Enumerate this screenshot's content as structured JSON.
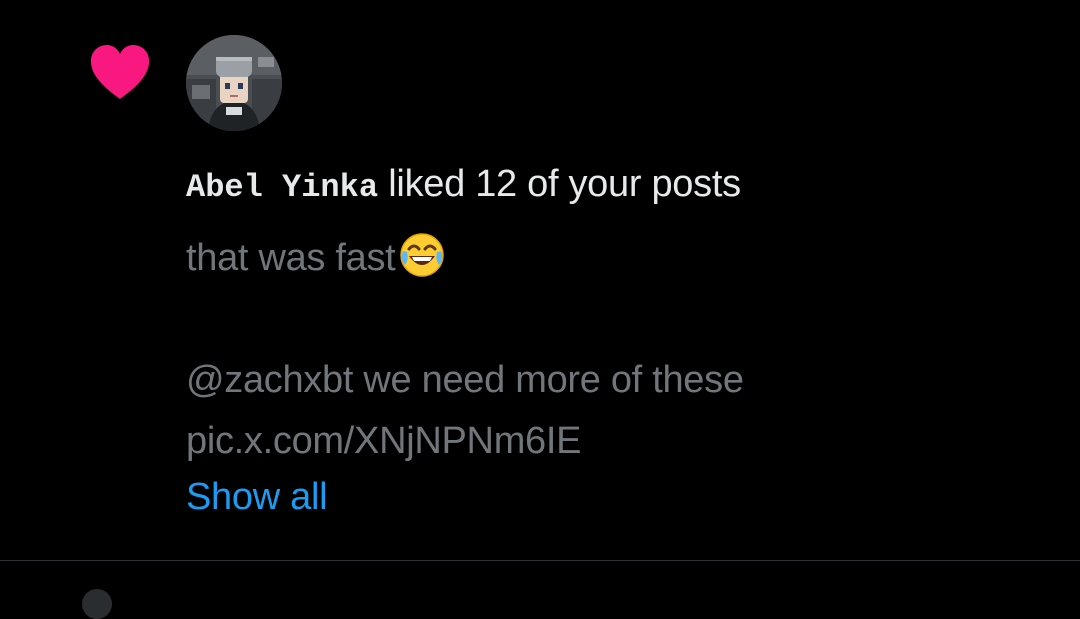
{
  "notification": {
    "type_icon": "heart-icon",
    "type_icon_color": "#f91880",
    "avatar_icon": "avatar-image",
    "user_name": "Abel Yinka",
    "action_text": " liked 12 of your posts",
    "post_line_1": "that was fast",
    "post_emoji": "face-with-tears-of-joy-icon",
    "post_line_2": "@zachxbt we need more of these",
    "post_line_3": "pic.x.com/XNjNPNm6IE",
    "show_all_label": "Show all"
  },
  "colors": {
    "background": "#000000",
    "primary_text": "#e7e9ea",
    "secondary_text": "#71767b",
    "link": "#1d9bf0",
    "divider": "#2f3336"
  }
}
